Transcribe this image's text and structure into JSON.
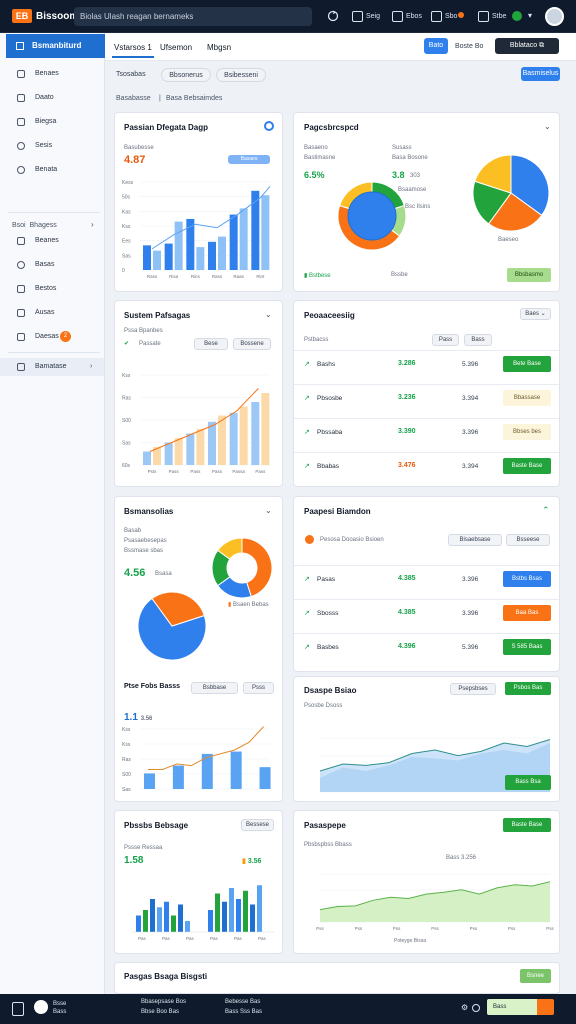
{
  "topbar": {
    "logo": "EB",
    "brand": "Bissoom",
    "search_text": "Biolas Ulash reagan bernameks",
    "items": [
      "Seig",
      "Ebos",
      "Sbo",
      "Stbe"
    ]
  },
  "colors": {
    "accent": "#2f80ed",
    "dark": "#0f1b2d",
    "green": "#22a33b",
    "orange": "#f97316"
  },
  "sidebar": {
    "header": "Bsmanbiturd",
    "items": [
      {
        "label": "Benaes",
        "icon": "box-icon"
      },
      {
        "label": "Daato",
        "icon": "folder-icon"
      },
      {
        "label": "Biegsa",
        "icon": "file-icon"
      },
      {
        "label": "Sesis",
        "icon": "user-icon"
      },
      {
        "label": "Benata",
        "icon": "clock-icon"
      }
    ],
    "section_label": "Bsoi",
    "section_title": "Bhagess",
    "items2": [
      {
        "label": "Beanes",
        "icon": "list-icon"
      },
      {
        "label": "Basas",
        "icon": "user-icon"
      },
      {
        "label": "Bestos",
        "icon": "pin-icon"
      },
      {
        "label": "Ausas",
        "icon": "gear-icon"
      },
      {
        "label": "Daesas",
        "icon": "card-icon",
        "badge": "2"
      }
    ],
    "footer_item": "Bamatase"
  },
  "page_head": {
    "tabs": [
      "Vstarsos 1",
      "Ufsemon",
      "Mbgsn"
    ],
    "btn_small": "Bato",
    "link": "Boste Bo",
    "btn_dark": "Bblataco"
  },
  "filters": {
    "label": "Tsosabas",
    "chips": [
      "Bbsonerus",
      "Bsibesseni"
    ],
    "btn": "Basmiselus",
    "breadcrumb": [
      "Basabasse",
      "Basa Bebsaimdes"
    ]
  },
  "card1": {
    "title": "Passian Dfegata Dagp",
    "sub": "Basubesse",
    "value": "4.87",
    "btn": "Basaes",
    "chart_data": {
      "type": "bar",
      "categories": [
        "Rass",
        "Risa",
        "Rins",
        "Rass",
        "Raas",
        "Rint"
      ],
      "values": [
        28,
        30,
        58,
        32,
        63,
        90
      ],
      "series2": [
        22,
        55,
        26,
        38,
        70,
        85
      ],
      "line": [
        24,
        40,
        52,
        48,
        64,
        82
      ],
      "ytick_labels": [
        "Kess",
        "50s",
        "Kas",
        "Kss",
        "Ees",
        "Sas",
        "0"
      ]
    }
  },
  "card2": {
    "title": "Pagcsbrcspcd",
    "labels": [
      "Basaeno",
      "Bastimasne",
      "Susass",
      "Basa Bosone",
      "Bsaamose",
      "Bsc Ilsins",
      "Baeseo"
    ],
    "values": [
      "6.5%",
      "3.8",
      "4.3%",
      "303"
    ],
    "legend": [
      "Bstbese",
      "Bsthace",
      "Bssbe"
    ],
    "btn": "Bbsbasmo",
    "chart_data": {
      "type": "pie",
      "slices": [
        {
          "label": "Basaeno",
          "value": 35,
          "color": "#2f80ed"
        },
        {
          "label": "Bastimasne",
          "value": 25,
          "color": "#f97316"
        },
        {
          "label": "Susass",
          "value": 20,
          "color": "#22a33b"
        },
        {
          "label": "Bsaamose",
          "value": 20,
          "color": "#fbbf24"
        }
      ]
    }
  },
  "card3": {
    "title": "Sustem Pafsagas",
    "sub": "Pssa Bpanbes",
    "chips": [
      "Passate",
      "Bese",
      "Bossene"
    ],
    "chart_data": {
      "type": "bar",
      "categories": [
        "Psts",
        "Pass",
        "Pass",
        "Pass",
        "Passa",
        "Pass"
      ],
      "values": [
        20,
        30,
        40,
        55,
        65,
        80
      ],
      "series2": [
        15,
        25,
        35,
        48,
        58,
        70
      ],
      "line": [
        15,
        25,
        35,
        45,
        60,
        85
      ],
      "ytick_labels": [
        "Kss",
        "Ras",
        "S00",
        "Sas",
        "60s"
      ]
    }
  },
  "card4": {
    "title": "Peoaaceesiig",
    "pill": "Baes",
    "sub": "Pstbacss",
    "pill2": "Pass",
    "pill3": "Bass",
    "rows": [
      {
        "label": "Bashs",
        "value": "3.286",
        "value_color": "green",
        "sub": "5.396",
        "btn": "Bete Base",
        "btn_style": "green"
      },
      {
        "label": "Pbsosbe",
        "value": "3.236",
        "value_color": "green",
        "sub": "3.394",
        "btn": "Bbassase",
        "btn_style": "pale"
      },
      {
        "label": "Pbssaba",
        "value": "3.390",
        "value_color": "green",
        "sub": "3.396",
        "btn": "Bbses bes",
        "btn_style": "pale"
      },
      {
        "label": "Bbabas",
        "value": "3.476",
        "value_color": "orange",
        "sub": "3.394",
        "btn": "Baste Base",
        "btn_style": "green"
      }
    ]
  },
  "card5": {
    "title": "Bsmansolias",
    "sub1": "Basab",
    "sub2": "Psasaebesepas",
    "sub3": "Bssmase sbas",
    "value": "4.56",
    "sub4": "Bsasa",
    "legend": [
      "Bbsbs",
      "Bssbss"
    ],
    "donut_label": "Bsaen Bebas",
    "chart_data": {
      "type": "pie",
      "slices": [
        {
          "label": "Bbsbs",
          "value": 70,
          "color": "#2f80ed"
        },
        {
          "label": "Bssbss",
          "value": 30,
          "color": "#f97316"
        }
      ],
      "donut": [
        {
          "value": 45,
          "color": "#f97316"
        },
        {
          "value": 20,
          "color": "#2f80ed"
        },
        {
          "value": 20,
          "color": "#22a33b"
        },
        {
          "value": 15,
          "color": "#fbbf24"
        }
      ]
    }
  },
  "card6": {
    "title": "Paapesi Biamdon",
    "sub": "Pesosa Dooasio Bsioen",
    "pill1": "Bisaebsase",
    "pill2": "Bsseese",
    "rows": [
      {
        "label": "Pasas",
        "value": "4.385",
        "value_color": "green",
        "sub": "3.396",
        "btn": "Bstbs Bsas",
        "btn_style": "blue"
      },
      {
        "label": "Sbosss",
        "value": "4.385",
        "value_color": "green",
        "sub": "3.396",
        "btn": "Baa Bas",
        "btn_style": "orange"
      },
      {
        "label": "Basbes",
        "value": "4.396",
        "value_color": "green",
        "sub": "5.396",
        "btn": "S 585 Baas",
        "btn_style": "green"
      }
    ]
  },
  "card7": {
    "title": "Ptse Fobs Basss",
    "pill1": "Bsbbase",
    "pill2": "Psss",
    "value": "1.1",
    "value_sub": "3.56",
    "chart_data": {
      "type": "bar",
      "categories": [
        "A",
        "B",
        "C",
        "D",
        "E",
        "F",
        "G",
        "H",
        "I"
      ],
      "values": [
        20,
        32,
        30,
        50,
        45,
        40,
        48,
        45,
        28
      ],
      "line": [
        25,
        25,
        32,
        30,
        40,
        45,
        50,
        60,
        80
      ],
      "ytick_labels": [
        "Kss",
        "Kss",
        "Ras",
        "S00",
        "Sas"
      ]
    }
  },
  "card8": {
    "title": "Dsaspe Bsiao",
    "pill": "Psepsbses",
    "btn1": "Psbos Bas",
    "btn2": "Bass Bsa",
    "sub": "Psosbe Dsoss",
    "chart_data": {
      "type": "area",
      "values": [
        30,
        40,
        38,
        42,
        55,
        60,
        52,
        58,
        70,
        65,
        75
      ],
      "values2": [
        20,
        35,
        30,
        38,
        50,
        48,
        45,
        55,
        60,
        55,
        70
      ]
    }
  },
  "card9": {
    "title": "Pbssbs Bebsage",
    "pill": "Bessese",
    "sub": "Pssse Ressaa",
    "value": "1.58",
    "value2": "3.56",
    "chart_data": {
      "type": "bar",
      "categories": [
        "Pas",
        "Pas",
        "Pas",
        "Pas",
        "Pas",
        "Pas"
      ],
      "groups": [
        [
          30,
          40,
          60,
          45,
          55,
          30,
          50,
          20
        ],
        [
          40,
          70,
          55,
          80,
          60,
          75,
          50,
          85
        ]
      ]
    }
  },
  "card10": {
    "title": "Pasaspepe",
    "btn": "Baste Base",
    "sub": "Pbsbspbss Bbass",
    "value": "Bass 3.256",
    "chart_data": {
      "type": "area",
      "values": [
        20,
        25,
        26,
        35,
        40,
        38,
        45,
        48,
        52,
        45,
        55,
        60,
        58,
        65
      ],
      "x_labels": [
        "Pss",
        "Pss",
        "Pss",
        "Pss",
        "Pss",
        "Pss",
        "Pss"
      ],
      "footer": "Poteyge Bissa"
    }
  },
  "card11": {
    "title": "Pasgas Bsaga Bisgsti",
    "btn": "Bsnee"
  },
  "footer": {
    "brand": "Bsse",
    "brand2": "Bass",
    "lines": [
      "Bbasepsase Bos",
      "Bbse Boo Bas",
      "Bebesse Bas",
      "Bass Sss Bas"
    ],
    "btn": "Bass"
  }
}
